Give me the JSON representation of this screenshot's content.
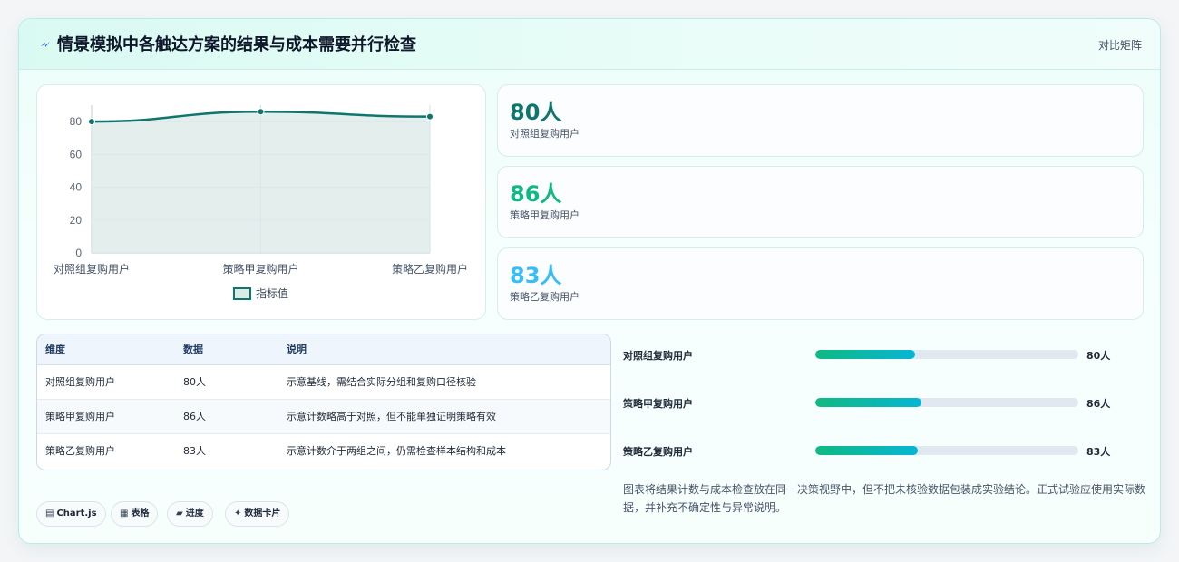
{
  "header": {
    "title": "情景模拟中各触达方案的结果与成本需要并行检查",
    "tag": "对比矩阵"
  },
  "chart_data": {
    "type": "line",
    "categories": [
      "对照组复购用户",
      "策略甲复购用户",
      "策略乙复购用户"
    ],
    "series": [
      {
        "name": "指标值",
        "values": [
          80,
          86,
          83
        ]
      }
    ],
    "yticks": [
      "0",
      "20",
      "40",
      "60",
      "80"
    ],
    "ylim": [
      0,
      90
    ],
    "legend_position": "bottom",
    "grid": true,
    "colors": {
      "line": "#0f766e",
      "area": "#dceae8"
    }
  },
  "kpis": [
    {
      "value": "80人",
      "label": "对照组复购用户",
      "color": "#0f766e"
    },
    {
      "value": "86人",
      "label": "策略甲复购用户",
      "color": "#10b981"
    },
    {
      "value": "83人",
      "label": "策略乙复购用户",
      "color": "#38bdf8"
    }
  ],
  "table": {
    "headers": [
      "维度",
      "数据",
      "说明"
    ],
    "rows": [
      [
        "对照组复购用户",
        "80人",
        "示意基线，需结合实际分组和复购口径核验"
      ],
      [
        "策略甲复购用户",
        "86人",
        "示意计数略高于对照，但不能单独证明策略有效"
      ],
      [
        "策略乙复购用户",
        "83人",
        "示意计数介于两组之间，仍需检查样本结构和成本"
      ]
    ]
  },
  "progress": [
    {
      "label": "对照组复购用户",
      "value": "80人",
      "fraction": 0.38
    },
    {
      "label": "策略甲复购用户",
      "value": "86人",
      "fraction": 0.405
    },
    {
      "label": "策略乙复购用户",
      "value": "83人",
      "fraction": 0.39
    }
  ],
  "note": "图表将结果计数与成本检查放在同一决策视野中，但不把未核验数据包装成实验结论。正式试验应使用实际数据，并补充不确定性与异常说明。",
  "chips": [
    {
      "icon": "▤",
      "label": "Chart.js"
    },
    {
      "icon": "▦",
      "label": "表格"
    },
    {
      "icon": "▰",
      "label": "进度"
    },
    {
      "icon": "✦",
      "label": "数据卡片"
    }
  ]
}
